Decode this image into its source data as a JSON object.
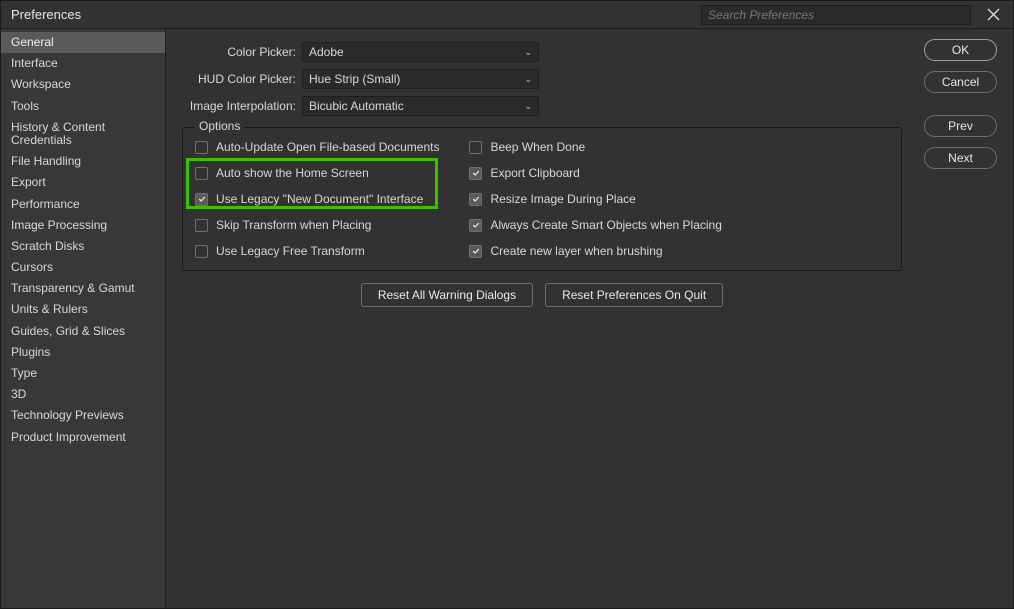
{
  "title": "Preferences",
  "search_placeholder": "Search Preferences",
  "sidebar": {
    "items": [
      {
        "label": "General",
        "selected": true
      },
      {
        "label": "Interface"
      },
      {
        "label": "Workspace"
      },
      {
        "label": "Tools"
      },
      {
        "label": "History & Content Credentials"
      },
      {
        "label": "File Handling"
      },
      {
        "label": "Export"
      },
      {
        "label": "Performance"
      },
      {
        "label": "Image Processing"
      },
      {
        "label": "Scratch Disks"
      },
      {
        "label": "Cursors"
      },
      {
        "label": "Transparency & Gamut"
      },
      {
        "label": "Units & Rulers"
      },
      {
        "label": "Guides, Grid & Slices"
      },
      {
        "label": "Plugins"
      },
      {
        "label": "Type"
      },
      {
        "label": "3D"
      },
      {
        "label": "Technology Previews"
      },
      {
        "label": "Product Improvement"
      }
    ]
  },
  "form": {
    "color_picker": {
      "label": "Color Picker:",
      "value": "Adobe"
    },
    "hud_color_picker": {
      "label": "HUD Color Picker:",
      "value": "Hue Strip (Small)"
    },
    "image_interpolation": {
      "label": "Image Interpolation:",
      "value": "Bicubic Automatic"
    }
  },
  "options": {
    "legend": "Options",
    "left": [
      {
        "label": "Auto-Update Open File-based Documents",
        "checked": false
      },
      {
        "label": "Auto show the Home Screen",
        "checked": false
      },
      {
        "label": "Use Legacy \"New Document\" Interface",
        "checked": true
      },
      {
        "label": "Skip Transform when Placing",
        "checked": false
      },
      {
        "label": "Use Legacy Free Transform",
        "checked": false
      }
    ],
    "right": [
      {
        "label": "Beep When Done",
        "checked": false
      },
      {
        "label": "Export Clipboard",
        "checked": true
      },
      {
        "label": "Resize Image During Place",
        "checked": true
      },
      {
        "label": "Always Create Smart Objects when Placing",
        "checked": true
      },
      {
        "label": "Create new layer when brushing",
        "checked": true
      }
    ]
  },
  "bottom_buttons": {
    "reset_warnings": "Reset All Warning Dialogs",
    "reset_on_quit": "Reset Preferences On Quit"
  },
  "right_buttons": {
    "ok": "OK",
    "cancel": "Cancel",
    "prev": "Prev",
    "next": "Next"
  },
  "highlight_box": {
    "color": "#39c100",
    "covers": [
      "Auto show the Home Screen",
      "Use Legacy \"New Document\" Interface"
    ]
  }
}
